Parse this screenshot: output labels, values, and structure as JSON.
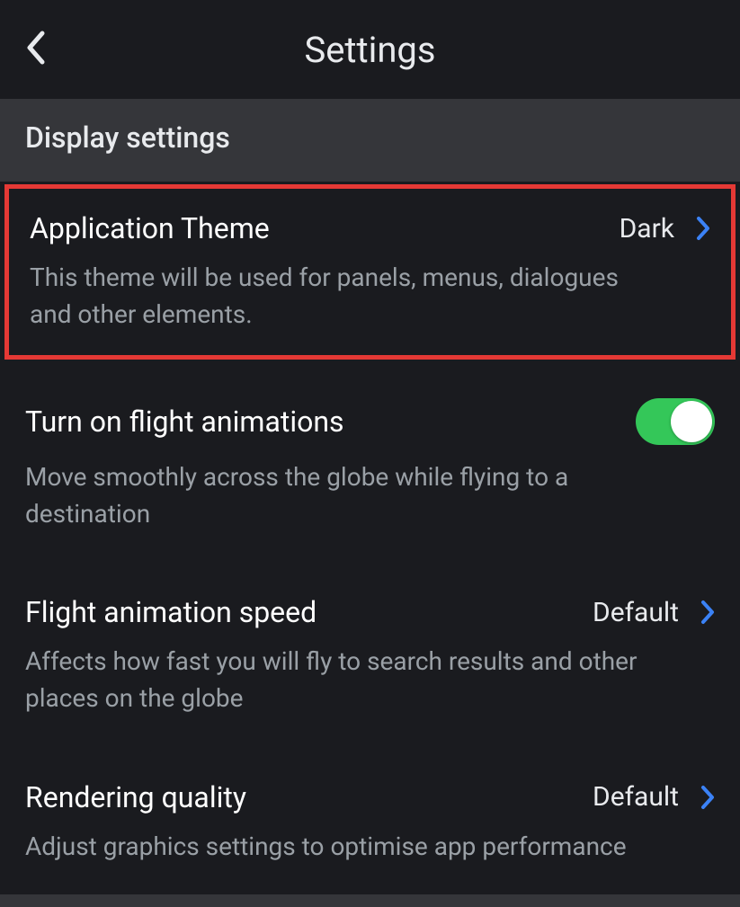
{
  "header": {
    "title": "Settings"
  },
  "section": {
    "title": "Display settings"
  },
  "settings": {
    "theme": {
      "title": "Application Theme",
      "value": "Dark",
      "description": "This theme will be used for panels, menus, dialogues and other elements."
    },
    "flight_animations": {
      "title": "Turn on flight animations",
      "description": "Move smoothly across the globe while flying to a destination",
      "enabled": true
    },
    "animation_speed": {
      "title": "Flight animation speed",
      "value": "Default",
      "description": "Affects how fast you will fly to search results and other places on the globe"
    },
    "rendering_quality": {
      "title": "Rendering quality",
      "value": "Default",
      "description": "Adjust graphics settings to optimise app performance"
    }
  }
}
